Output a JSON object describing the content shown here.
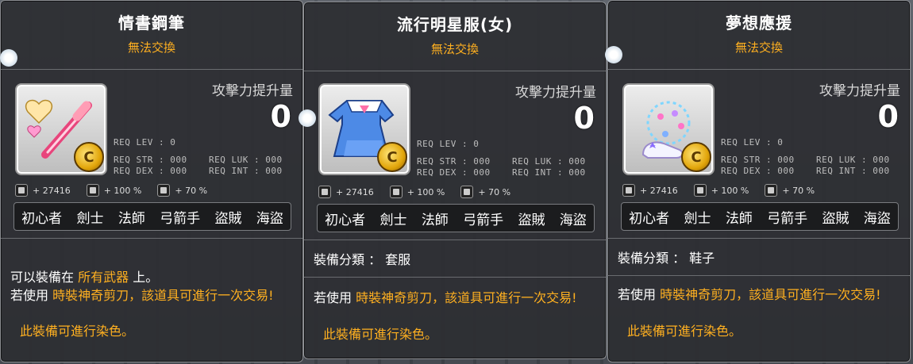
{
  "tooltips": [
    {
      "name": "情書鋼筆",
      "untradeable": "無法交換",
      "attack_label": "攻擊力提升量",
      "attack_value": "0",
      "req_lev": "REQ LEV :   0",
      "req_str": "REQ STR : 000",
      "req_dex": "REQ DEX : 000",
      "req_luk": "REQ LUK : 000",
      "req_int": "REQ INT : 000",
      "stat1": "+ 27416",
      "stat2": "+ 100 %",
      "stat3": "+ 70 %",
      "jobs": [
        "初心者",
        "劍士",
        "法師",
        "弓箭手",
        "盜賊",
        "海盜"
      ],
      "desc_prefix": "可以裝備在",
      "desc_highlight": "所有武器",
      "desc_suffix": "上。",
      "use_prefix": "若使用",
      "use_highlight": "時裝神奇剪刀，該道具可進行一次交易!",
      "dye": "此裝備可進行染色。"
    },
    {
      "name": "流行明星服(女)",
      "untradeable": "無法交換",
      "attack_label": "攻擊力提升量",
      "attack_value": "0",
      "req_lev": "REQ LEV :   0",
      "req_str": "REQ STR : 000",
      "req_dex": "REQ DEX : 000",
      "req_luk": "REQ LUK : 000",
      "req_int": "REQ INT : 000",
      "stat1": "+ 27416",
      "stat2": "+ 100 %",
      "stat3": "+ 70 %",
      "jobs": [
        "初心者",
        "劍士",
        "法師",
        "弓箭手",
        "盜賊",
        "海盜"
      ],
      "category": "裝備分類 ： 套服",
      "use_prefix": "若使用",
      "use_highlight": "時裝神奇剪刀，該道具可進行一次交易!",
      "dye": "此裝備可進行染色。"
    },
    {
      "name": "夢想應援",
      "untradeable": "無法交換",
      "attack_label": "攻擊力提升量",
      "attack_value": "0",
      "req_lev": "REQ LEV :   0",
      "req_str": "REQ STR : 000",
      "req_dex": "REQ DEX : 000",
      "req_luk": "REQ LUK : 000",
      "req_int": "REQ INT : 000",
      "stat1": "+ 27416",
      "stat2": "+ 100 %",
      "stat3": "+ 70 %",
      "jobs": [
        "初心者",
        "劍士",
        "法師",
        "弓箭手",
        "盜賊",
        "海盜"
      ],
      "category": "裝備分類 ： 鞋子",
      "use_prefix": "若使用",
      "use_highlight": "時裝神奇剪刀，該道具可進行一次交易!",
      "dye": "此裝備可進行染色。"
    }
  ],
  "colors": {
    "accent_orange": "#ffb020",
    "panel_bg": "#2c2e32",
    "text": "#ffffff"
  }
}
